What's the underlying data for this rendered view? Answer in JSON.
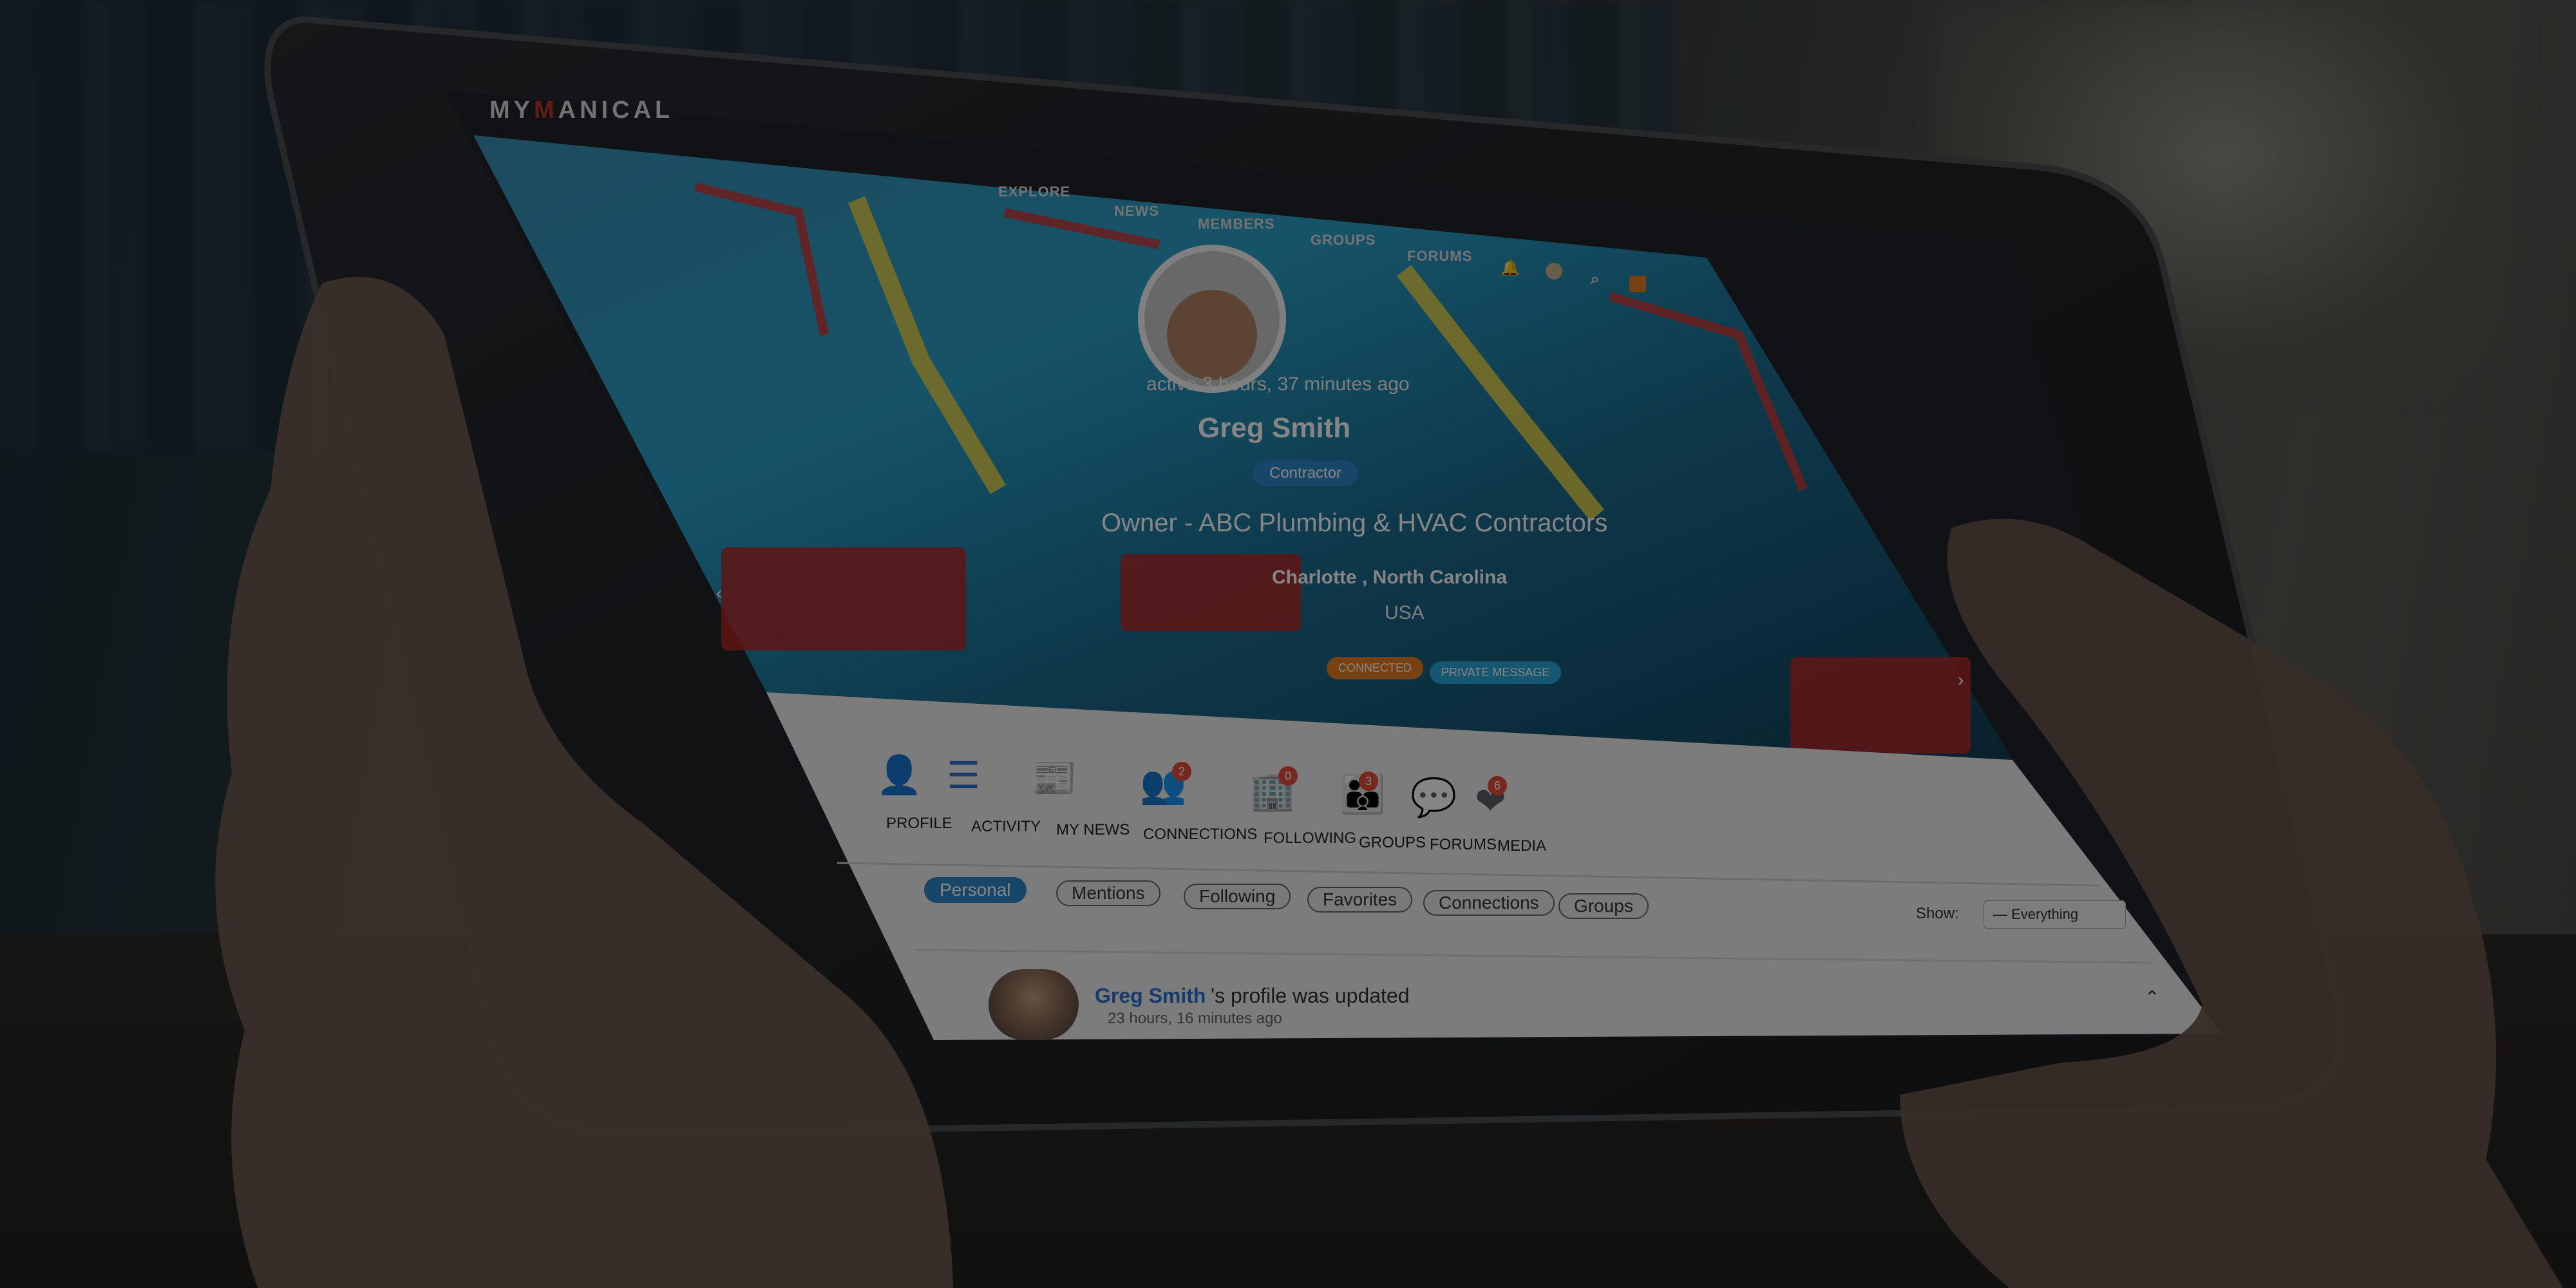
{
  "app": {
    "logo_text_left": "MY",
    "logo_text_mid": "M",
    "logo_text_right": "ANICAL"
  },
  "nav": {
    "items": [
      "EXPLORE",
      "NEWS",
      "MEMBERS",
      "GROUPS",
      "FORUMS"
    ]
  },
  "profile": {
    "active": "active 3 hours, 37 minutes ago",
    "name": "Greg Smith",
    "role_badge": "Contractor",
    "title": "Owner - ABC Plumbing & HVAC Contractors",
    "location": "Charlotte , North Carolina",
    "country": "USA",
    "buttons": {
      "connected": "CONNECTED",
      "private_message": "PRIVATE MESSAGE"
    }
  },
  "tabs": [
    {
      "label": "PROFILE",
      "icon": "person-icon",
      "count": ""
    },
    {
      "label": "ACTIVITY",
      "icon": "list-icon",
      "count": ""
    },
    {
      "label": "MY NEWS",
      "icon": "newspaper-icon",
      "count": ""
    },
    {
      "label": "CONNECTIONS",
      "icon": "people-icon",
      "count": "2"
    },
    {
      "label": "FOLLOWING",
      "icon": "building-icon",
      "count": "0"
    },
    {
      "label": "GROUPS",
      "icon": "group-icon",
      "count": "3"
    },
    {
      "label": "FORUMS",
      "icon": "chat-icon",
      "count": ""
    },
    {
      "label": "MEDIA",
      "icon": "heart-icon",
      "count": "6"
    }
  ],
  "filters": [
    "Personal",
    "Mentions",
    "Following",
    "Favorites",
    "Connections",
    "Groups"
  ],
  "show": {
    "label": "Show:",
    "selected": "— Everything"
  },
  "feed": {
    "name": "Greg Smith",
    "text": "'s profile was updated",
    "time": "23 hours, 16 minutes ago"
  },
  "colors": {
    "brand_red": "#c0392b",
    "active_blue": "#2e86c8",
    "connected_orange": "#e67e22",
    "pm_blue": "#2aa6d8"
  }
}
